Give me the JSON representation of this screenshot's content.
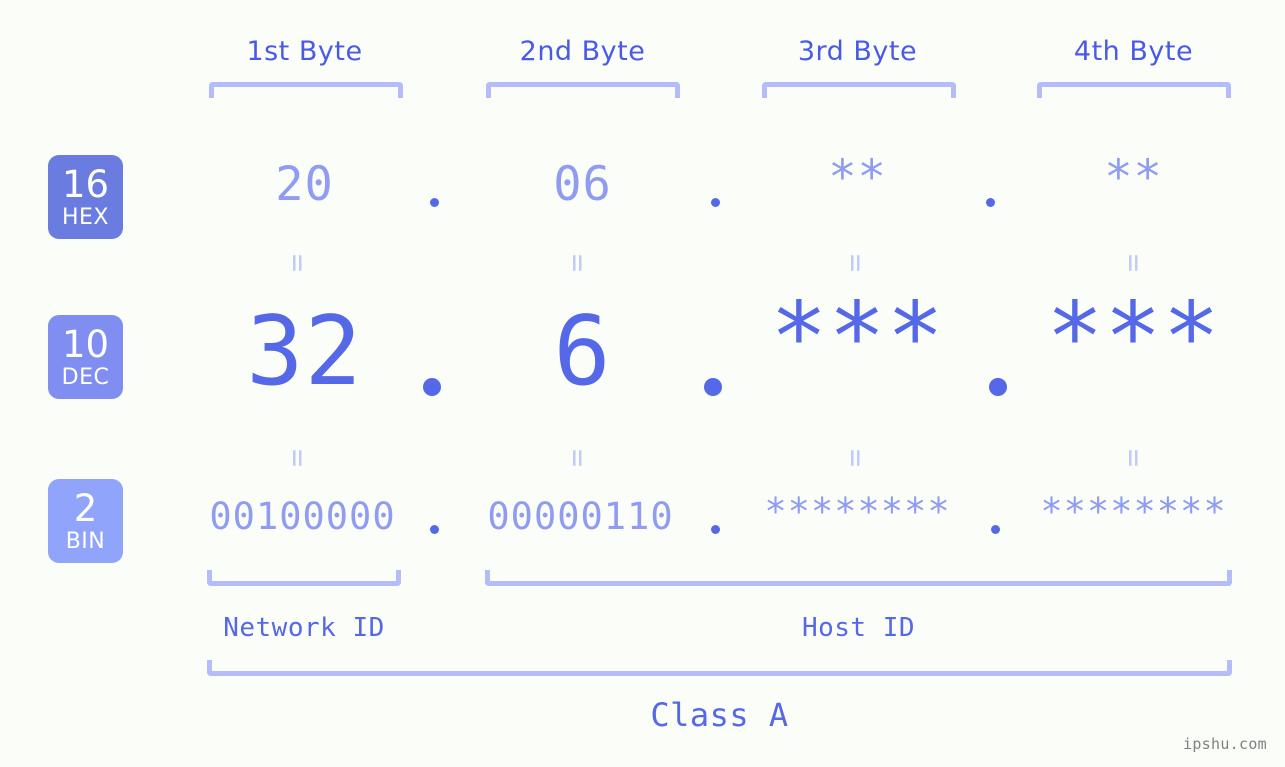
{
  "meta": {
    "watermark": "ipshu.com",
    "background_color": "#fbfdf8"
  },
  "colors": {
    "header_blue": "#4a5ae8",
    "bracket_lavender": "#b4bdfa",
    "value_light": "#8f9cf2",
    "value_strong": "#5468e8",
    "equals_light": "#c3cbfb",
    "badge_hex": "#6b7ce0",
    "badge_dec": "#7f8ef0",
    "badge_bin": "#8fa4fa",
    "watermark_gray": "#808080"
  },
  "byte_headers": [
    {
      "label": "1st Byte"
    },
    {
      "label": "2nd Byte"
    },
    {
      "label": "3rd Byte"
    },
    {
      "label": "4th Byte"
    }
  ],
  "bases": [
    {
      "number": "16",
      "name": "HEX",
      "color": "#6b7ce0"
    },
    {
      "number": "10",
      "name": "DEC",
      "color": "#7f8ef0"
    },
    {
      "number": "2",
      "name": "BIN",
      "color": "#8fa4fa"
    }
  ],
  "rows": {
    "hex": {
      "base_number": "16",
      "base_name": "HEX",
      "values": [
        "20",
        "06",
        "**",
        "**"
      ],
      "separator": "."
    },
    "dec": {
      "base_number": "10",
      "base_name": "DEC",
      "values": [
        "32",
        "6",
        "***",
        "***"
      ],
      "separator": "."
    },
    "bin": {
      "base_number": "2",
      "base_name": "BIN",
      "values": [
        "00100000",
        "00000110",
        "********",
        "********"
      ],
      "separator": "."
    }
  },
  "equals_symbol": "=",
  "segments": {
    "network_id": "Network ID",
    "host_id": "Host ID",
    "class": "Class A"
  }
}
